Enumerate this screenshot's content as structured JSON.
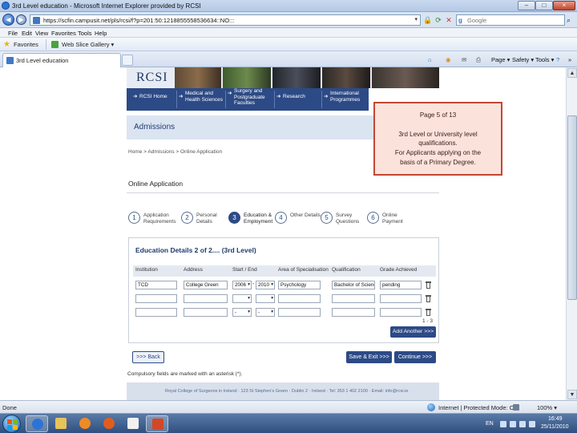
{
  "window": {
    "title": "3rd Level education - Microsoft Internet Explorer provided by RCSI",
    "min_label": "–",
    "max_label": "□",
    "close_label": "×"
  },
  "address": {
    "back_glyph": "◀",
    "forward_glyph": "▶",
    "url": "https://scfin.campusit.net/pls/rcsi/f?p=201:50:1218855558536634::NO:::",
    "dropdown": "▾",
    "search_placeholder": "Google",
    "search_go": "⌕"
  },
  "menu": [
    "File",
    "Edit",
    "View",
    "Favorites",
    "Tools",
    "Help"
  ],
  "favorites": {
    "star": "★",
    "label": "Favorites",
    "web_slice": "Web Slice Gallery ▾"
  },
  "tab": {
    "label": "3rd Level education"
  },
  "commandbar": {
    "page": "Page ▾",
    "safety": "Safety ▾",
    "tools": "Tools ▾",
    "help": "?",
    "more": "»"
  },
  "site": {
    "logo": "RCSI",
    "nav": [
      {
        "arrow": "➔",
        "label": "RCSI Home"
      },
      {
        "arrow": "➔",
        "label": "Medical and Health Sciences"
      },
      {
        "arrow": "➔",
        "label": "Surgery and Postgraduate Faculties"
      },
      {
        "arrow": "➔",
        "label": "Research"
      },
      {
        "arrow": "➔",
        "label": "International Programmes"
      }
    ],
    "section_heading": "Admissions",
    "breadcrumb": "Home > Admissions > Online Application",
    "page_heading": "Online Application",
    "steps": [
      {
        "num": "1",
        "label": "Application Requirements"
      },
      {
        "num": "2",
        "label": "Personal Details"
      },
      {
        "num": "3",
        "label": "Education & Employment"
      },
      {
        "num": "4",
        "label": "Other Details"
      },
      {
        "num": "5",
        "label": "Survey Questions"
      },
      {
        "num": "6",
        "label": "Online Payment"
      }
    ],
    "form": {
      "title": "Education Details 2 of 2.... (3rd Level)",
      "columns": [
        "Institution",
        "Address",
        "Start / End",
        "Area of Specialisation",
        "Qualification",
        "Grade Achieved"
      ],
      "rows": [
        {
          "institution": "TCD",
          "address": "College Green",
          "start": "2006",
          "end": "2010",
          "area": "Psychology",
          "qualification": "Bachelor of Science",
          "grade": "pending"
        },
        {
          "institution": "",
          "address": "",
          "start": "",
          "end": "",
          "area": "",
          "qualification": "",
          "grade": ""
        },
        {
          "institution": "",
          "address": "",
          "start": "-",
          "end": "-",
          "area": "",
          "qualification": "",
          "grade": ""
        }
      ],
      "dash": "-",
      "pager": "1 - 3",
      "add_another": "Add Another >>>"
    },
    "back_button": ">>> Back",
    "save_exit_button": "Save & Exit >>>",
    "continue_button": "Continue >>>",
    "compulsory_note": "Compulsory fields are marked with an asterisk (*).",
    "footer": "Royal College of Surgeons in Ireland · 123 St Stephen's Green · Dublin 2 · Ireland · Tel: 353 1 402 2100 · Email: info@rcsi.ie"
  },
  "callout": {
    "page": "Page 5 of 13",
    "line1": "3rd Level or University level",
    "line2": "qualifications.",
    "line3": "For Applicants applying on the",
    "line4": "basis of a Primary Degree."
  },
  "status": {
    "left": "Done",
    "zone": "Internet | Protected Mode: Off",
    "zoom": "100% ▾"
  },
  "tray": {
    "lang": "EN",
    "time": "16:49",
    "date": "25/11/2010"
  }
}
